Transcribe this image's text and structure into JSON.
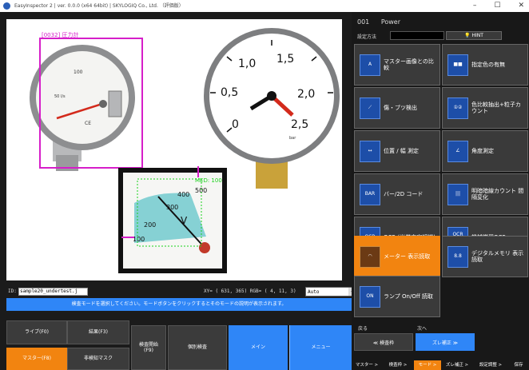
{
  "window": {
    "title": "EasyInspector 2 | ver. 0.0.0 (x64 64bit) | SKYLOGIQ Co., Ltd. （評価版）",
    "minimize": "–",
    "maximize": "☐",
    "close": "✕"
  },
  "canvas": {
    "detect_label": "[0032] 圧力計",
    "meter_label": "MED: 100",
    "gauge1_marks": [
      "100",
      "50 l/s"
    ],
    "gauge2_numbers": [
      "0",
      "0,5",
      "1,0",
      "1,5",
      "2,0",
      "2,5"
    ],
    "gauge2_unit": "bar",
    "gauge3_numbers": [
      "100",
      "200",
      "300",
      "400",
      "500"
    ],
    "gauge3_unit": "V"
  },
  "info": {
    "id_label": "ID:",
    "id_value": "sample20_undertest.j",
    "coords": "XY= ( 631,  365)  RGB= (  4,  11,   3)",
    "mode": "Auto",
    "dropdown_glyph": "▾"
  },
  "hint": "検査モードを選択してください。モードボタンをクリックするとそのモードの説明が表示されます。",
  "bottom_buttons": {
    "live": "ライブ(F0)",
    "result": "結果(F3)",
    "master": "マスター(F8)",
    "nondetect_mask": "非検知マスク",
    "start_inspection": "検査開始\n(F9)",
    "individual_check": "個別検査",
    "main": "メイン",
    "menu": "メニュー"
  },
  "right_panel": {
    "program_no": "001",
    "program_name": "Power",
    "method_label": "設定方法",
    "hint_button": "HINT",
    "tiles": [
      {
        "label": "マスター画像との比較",
        "icon_text": "A"
      },
      {
        "label": "指定色の有無",
        "icon_text": "■■"
      },
      {
        "label": "傷・ブツ検出",
        "icon_text": "⟋"
      },
      {
        "label": "色比較抽出+粒子カウント",
        "icon_text": "①②"
      },
      {
        "label": "位置 / 幅 測定",
        "icon_text": "↔"
      },
      {
        "label": "角度測定",
        "icon_text": "∠"
      },
      {
        "label": "バー/2D コード",
        "icon_text": "BAR"
      },
      {
        "label": "明暗暗線カウント 間隔変化",
        "icon_text": "|||"
      },
      {
        "label": "OCR (光学文字認識)",
        "icon_text": "OCR"
      },
      {
        "label": "機械学習OCR",
        "icon_text": "OCR PRO"
      },
      {
        "label": "メーター 表示読取",
        "icon_text": "◠"
      },
      {
        "label": "デジタルメモリ 表示読取",
        "icon_text": "8.8"
      },
      {
        "label": "ランプ On/Off 読取",
        "icon_text": "ON"
      }
    ],
    "nav_prev_label": "戻る",
    "nav_next_label": "次へ",
    "prev_button": "≪ 検査枠",
    "next_button": "ズレ補正 ≫",
    "steps": [
      "マスター >",
      "検査枠 >",
      "モード >",
      "ズレ補正 >",
      "設定調整 >",
      "保存"
    ]
  },
  "colors": {
    "accent_blue": "#2f86f7",
    "accent_orange": "#f28410",
    "detect_box": "#d61ec9",
    "meter_box": "#1bd11b"
  }
}
